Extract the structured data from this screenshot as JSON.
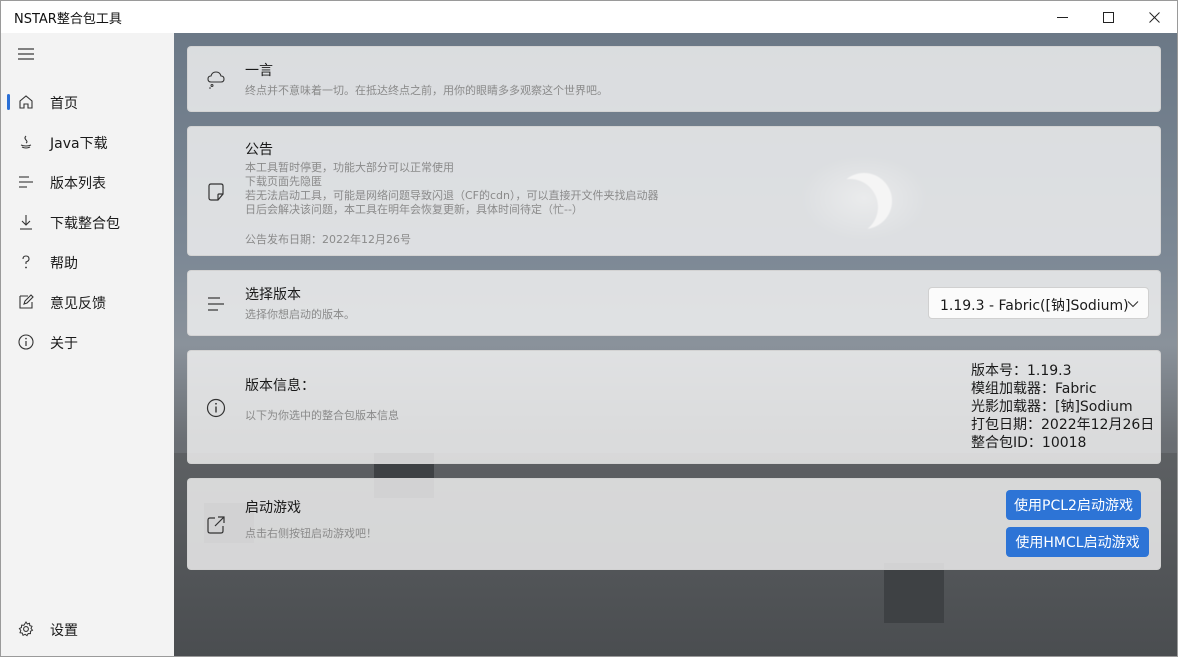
{
  "window": {
    "title": "NSTAR整合包工具"
  },
  "sidebar": {
    "items": [
      {
        "label": "首页",
        "icon": "home-icon"
      },
      {
        "label": "Java下载",
        "icon": "java-icon"
      },
      {
        "label": "版本列表",
        "icon": "list-icon"
      },
      {
        "label": "下载整合包",
        "icon": "download-icon"
      },
      {
        "label": "帮助",
        "icon": "help-icon"
      },
      {
        "label": "意见反馈",
        "icon": "feedback-icon"
      },
      {
        "label": "关于",
        "icon": "info-icon"
      }
    ],
    "settings_label": "设置",
    "active_index": 0
  },
  "cards": {
    "quote": {
      "title": "一言",
      "subtitle": "终点并不意味着一切。在抵达终点之前，用你的眼睛多多观察这个世界吧。"
    },
    "notice": {
      "title": "公告",
      "lines": [
        "本工具暂时停更，功能大部分可以正常使用",
        "下载页面先隐匿",
        "若无法启动工具，可能是网络问题导致闪退（CF的cdn），可以直接开文件夹找启动器",
        "日后会解决该问题，本工具在明年会恢复更新，具体时间待定（忙--）"
      ],
      "date": "公告发布日期：2022年12月26号"
    },
    "version_select": {
      "title": "选择版本",
      "subtitle": "选择你想启动的版本。",
      "selected": "1.19.3 - Fabric([钠]Sodium)"
    },
    "version_info": {
      "title": "版本信息：",
      "subtitle": "以下为你选中的整合包版本信息",
      "lines": [
        "版本号：1.19.3",
        "模组加载器：Fabric",
        "光影加载器：[钠]Sodium",
        "打包日期：2022年12月26日",
        "整合包ID：10018"
      ]
    },
    "launch": {
      "title": "启动游戏",
      "subtitle": "点击右侧按钮启动游戏吧！",
      "pcl2_label": "使用PCL2启动游戏",
      "hmcl_label": "使用HMCL启动游戏"
    }
  },
  "colors": {
    "accent": "#2d74d6",
    "sidebar_bg": "#f3f3f3"
  }
}
